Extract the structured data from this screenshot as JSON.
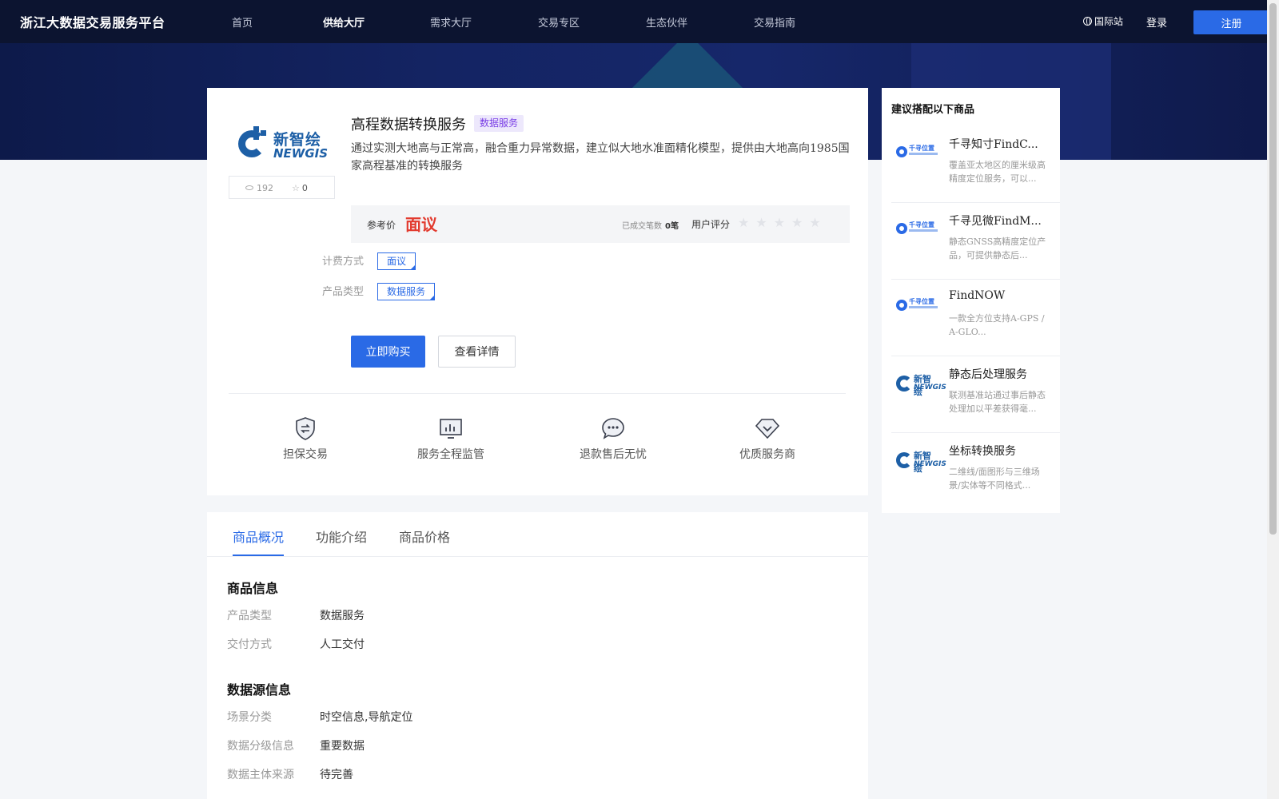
{
  "header": {
    "brand": "浙江大数据交易服务平台",
    "nav": [
      "首页",
      "供给大厅",
      "需求大厅",
      "交易专区",
      "生态伙伴",
      "交易指南"
    ],
    "active_nav": "供给大厅",
    "intl": "国际站",
    "login": "登录",
    "register": "注册"
  },
  "product": {
    "logo_cn": "新智绘",
    "logo_en": "NEWGIS",
    "views": "192",
    "favorites": "0",
    "title": "高程数据转换服务",
    "tag": "数据服务",
    "description": "通过实测大地高与正常高，融合重力异常数据，建立似大地水准面精化模型，提供由大地高向1985国家高程基准的转换服务",
    "price_label": "参考价",
    "price": "面议",
    "deals_label": "已成交笔数",
    "deals_value": "0笔",
    "rating_label": "用户评分",
    "rating_value": 0,
    "rating_max": 5,
    "billing_label": "计费方式",
    "billing_value": "面议",
    "type_label": "产品类型",
    "type_value": "数据服务",
    "buy_button": "立即购买",
    "detail_button": "查看详情"
  },
  "features": [
    {
      "icon": "shield-exchange-icon",
      "label": "担保交易"
    },
    {
      "icon": "monitor-chart-icon",
      "label": "服务全程监管"
    },
    {
      "icon": "chat-bubble-icon",
      "label": "退款售后无忧"
    },
    {
      "icon": "diamond-check-icon",
      "label": "优质服务商"
    }
  ],
  "tabs": [
    "商品概况",
    "功能介绍",
    "商品价格"
  ],
  "active_tab": "商品概况",
  "overview": {
    "product_info_title": "商品信息",
    "product_info": [
      {
        "k": "产品类型",
        "v": "数据服务"
      },
      {
        "k": "交付方式",
        "v": "人工交付"
      }
    ],
    "source_info_title": "数据源信息",
    "source_info": [
      {
        "k": "场景分类",
        "v": "时空信息,导航定位"
      },
      {
        "k": "数据分级信息",
        "v": "重要数据"
      },
      {
        "k": "数据主体来源",
        "v": "待完善"
      }
    ]
  },
  "side": {
    "title": "建议搭配以下商品",
    "items": [
      {
        "logo": "qianxun-logo",
        "name": "千寻知寸FindC...",
        "desc": "覆盖亚太地区的厘米级高精度定位服务，可以..."
      },
      {
        "logo": "qianxun-logo",
        "name": "千寻见微FindM...",
        "desc": "静态GNSS高精度定位产品，可提供静态后..."
      },
      {
        "logo": "qianxun-logo",
        "name": "FindNOW",
        "desc": "一款全方位支持A-GPS / A-GLO..."
      },
      {
        "logo": "newgis-logo",
        "name": "静态后处理服务",
        "desc": "联测基准站通过事后静态处理加以平差获得毫..."
      },
      {
        "logo": "newgis-logo",
        "name": "坐标转换服务",
        "desc": "二维线/面图形与三维场景/实体等不同格式..."
      }
    ],
    "qianxun_text": "千寻位置",
    "newgis_cn": "新智绘",
    "newgis_en": "NEWGIS"
  },
  "colors": {
    "accent": "#2a6ae6",
    "header_bg": "#0c1430",
    "price_red": "#e23a2e",
    "tag_purple": "#7a3ee6"
  }
}
